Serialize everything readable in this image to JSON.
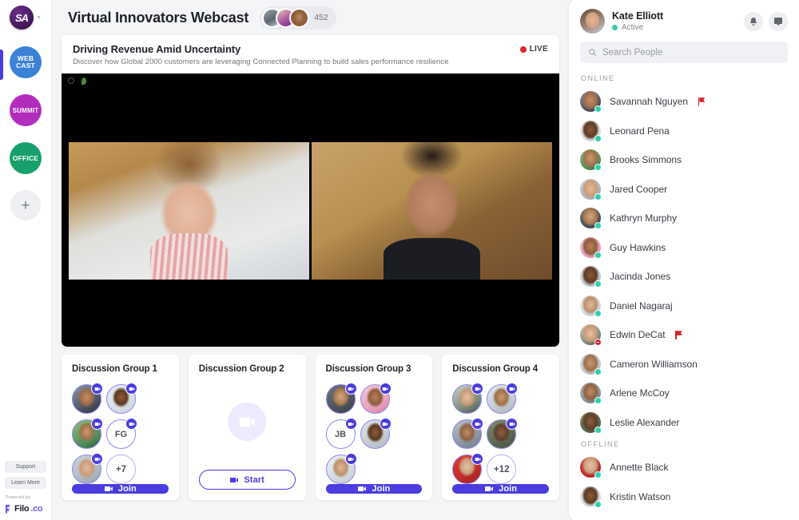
{
  "rail": {
    "logo_text": "SA",
    "items": [
      {
        "label": "WEB\nCAST",
        "line1": "WEB",
        "line2": "CAST",
        "color": "#3b82d6",
        "active": true
      },
      {
        "label": "SUMMIT",
        "line1": "SUM",
        "line2": "MIT",
        "color": "#b32dbd",
        "active": false
      },
      {
        "label": "OFFICE",
        "line1": "OFF",
        "line2": "ICE",
        "color": "#17a06b",
        "active": false
      }
    ],
    "add_label": "+",
    "support_label": "Support",
    "learn_more_label": "Learn More",
    "powered_by": "Powered by",
    "brand_name": "Filo",
    "brand_tld": ".co"
  },
  "header": {
    "title": "Virtual Innovators Webcast",
    "attendee_count": "452"
  },
  "webcast": {
    "title": "Driving Revenue Amid Uncertainty",
    "subtitle": "Discover how Global 2000 customers are leveraging Connected Planning to build sales performance resilience",
    "live_label": "LIVE"
  },
  "groups": [
    {
      "title": "Discussion Group 1",
      "button_label": "Join",
      "button_type": "join",
      "avatars": [
        {
          "type": "photo",
          "tone": "a"
        },
        {
          "type": "photo",
          "tone": "b"
        },
        {
          "type": "photo",
          "tone": "c"
        },
        {
          "type": "initials",
          "text": "FG"
        },
        {
          "type": "photo",
          "tone": "d"
        },
        {
          "type": "more",
          "text": "+7"
        }
      ]
    },
    {
      "title": "Discussion Group 2",
      "button_label": "Start",
      "button_type": "start",
      "avatars": []
    },
    {
      "title": "Discussion Group 3",
      "button_label": "Join",
      "button_type": "join",
      "avatars": [
        {
          "type": "photo",
          "tone": "e"
        },
        {
          "type": "photo",
          "tone": "f"
        },
        {
          "type": "initials",
          "text": "JB"
        },
        {
          "type": "photo",
          "tone": "g"
        },
        {
          "type": "photo",
          "tone": "h"
        }
      ]
    },
    {
      "title": "Discussion Group 4",
      "button_label": "Join",
      "button_type": "join",
      "avatars": [
        {
          "type": "photo",
          "tone": "i"
        },
        {
          "type": "photo",
          "tone": "j"
        },
        {
          "type": "photo",
          "tone": "k"
        },
        {
          "type": "photo",
          "tone": "l"
        },
        {
          "type": "photo",
          "tone": "m"
        },
        {
          "type": "more",
          "text": "+12"
        }
      ]
    }
  ],
  "people_panel": {
    "current_user": {
      "name": "Kate Elliott",
      "status": "Active"
    },
    "search": {
      "placeholder": "Search People",
      "value": ""
    },
    "sections": [
      {
        "label": "ONLINE",
        "people": [
          {
            "name": "Savannah Nguyen",
            "presence": "online",
            "flag": true
          },
          {
            "name": "Leonard Pena",
            "presence": "online",
            "flag": false
          },
          {
            "name": "Brooks Simmons",
            "presence": "online",
            "flag": false
          },
          {
            "name": "Jared Cooper",
            "presence": "online",
            "flag": false
          },
          {
            "name": "Kathryn Murphy",
            "presence": "online",
            "flag": false
          },
          {
            "name": "Guy Hawkins",
            "presence": "online",
            "flag": false
          },
          {
            "name": "Jacinda Jones",
            "presence": "online",
            "flag": false
          },
          {
            "name": "Daniel Nagaraj",
            "presence": "online",
            "flag": false
          },
          {
            "name": "Edwin DeCat",
            "presence": "busy",
            "flag": true
          },
          {
            "name": "Cameron Williamson",
            "presence": "online",
            "flag": false
          },
          {
            "name": "Arlene McCoy",
            "presence": "online",
            "flag": false
          },
          {
            "name": "Leslie Alexander",
            "presence": "online",
            "flag": false
          }
        ]
      },
      {
        "label": "OFFLINE",
        "people": [
          {
            "name": "Annette Black",
            "presence": "online",
            "flag": false
          },
          {
            "name": "Kristin Watson",
            "presence": "online",
            "flag": false
          }
        ]
      }
    ]
  },
  "colors": {
    "accent": "#4b3ce0",
    "live": "#e0232e",
    "online": "#2ecfae",
    "page_bg": "#f4f5f7"
  }
}
